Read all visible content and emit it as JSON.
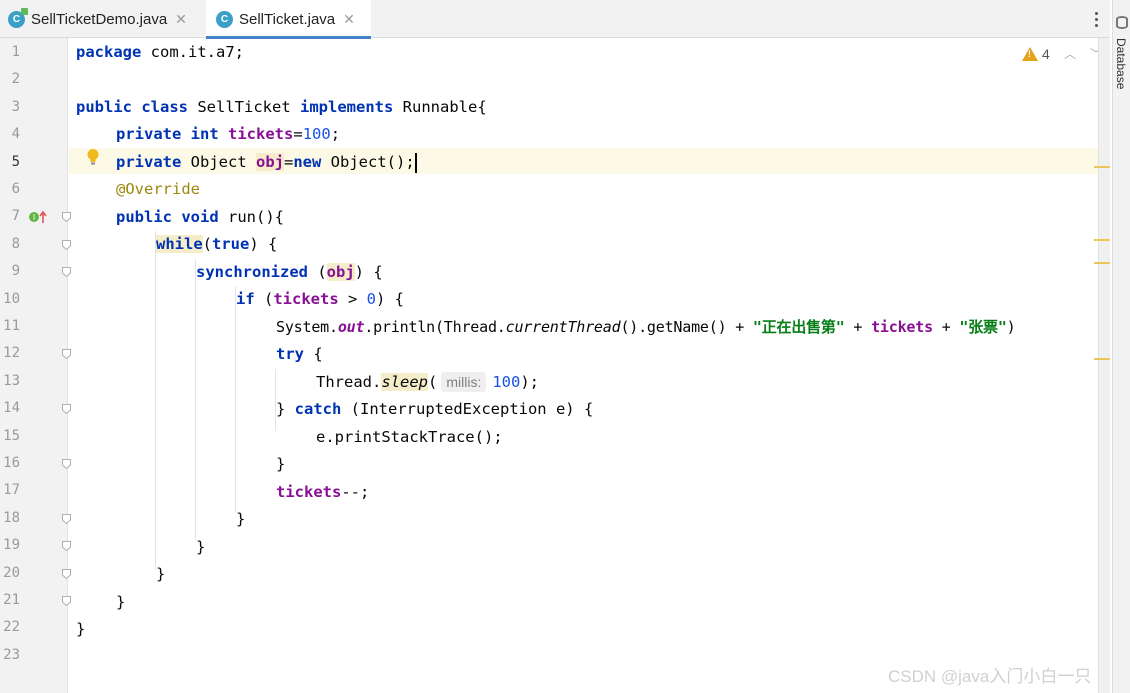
{
  "tabs": [
    {
      "name": "SellTicketDemo.java",
      "icon_letter": "C"
    },
    {
      "name": "SellTicket.java",
      "icon_letter": "C"
    }
  ],
  "toolstrip": {
    "database_label": "Database"
  },
  "inspection": {
    "warning_count": "4"
  },
  "hint": {
    "millis_label": "millis:"
  },
  "watermark": "CSDN @java入门小白一只",
  "line_numbers": [
    "1",
    "2",
    "3",
    "4",
    "5",
    "6",
    "7",
    "8",
    "9",
    "10",
    "11",
    "12",
    "13",
    "14",
    "15",
    "16",
    "17",
    "18",
    "19",
    "20",
    "21",
    "22",
    "23"
  ],
  "code": {
    "l1": {
      "kw": "package",
      "rest": " com.it.a7;"
    },
    "l3": {
      "kw1": "public",
      "kw2": "class",
      "cls": " SellTicket ",
      "kw3": "implements",
      "rest": " Runnable{"
    },
    "l4": {
      "kw1": "private",
      "kw2": "int",
      "field": "tickets",
      "eq": "=",
      "num": "100",
      "end": ";"
    },
    "l5": {
      "kw1": "private",
      "type": " Object ",
      "field": "obj",
      "eq": "=",
      "kw2": "new",
      "rest": " Object();"
    },
    "l6": {
      "ann": "@Override"
    },
    "l7": {
      "kw1": "public",
      "kw2": "void",
      "rest": " run(){"
    },
    "l8": {
      "kw1": "while",
      "p1": "(",
      "kw2": "true",
      "rest": ") {"
    },
    "l9": {
      "kw": "synchronized",
      "p1": " (",
      "field": "obj",
      "rest": ") {"
    },
    "l10": {
      "kw": "if",
      "p1": " (",
      "field": "tickets",
      "p2": " > ",
      "num": "0",
      "rest": ") {"
    },
    "l11": {
      "a": "System.",
      "out": "out",
      "b": ".println(Thread.",
      "ct": "currentThread",
      "c": "().getName() + ",
      "s1": "\"正在出售第\"",
      "d": " + ",
      "field": "tickets",
      "e": " + ",
      "s2": "\"张票\"",
      "f": ")"
    },
    "l12": {
      "kw": "try",
      "rest": " {"
    },
    "l13": {
      "a": "Thread.",
      "sleep": "sleep",
      "p": "(",
      "num": "100",
      "end": ");"
    },
    "l14": {
      "a": "} ",
      "kw": "catch",
      "rest": " (InterruptedException e) {"
    },
    "l15": {
      "text": "e.printStackTrace();"
    },
    "l16": {
      "text": "}"
    },
    "l17": {
      "field": "tickets",
      "rest": "--;"
    },
    "l18": {
      "text": "}"
    },
    "l19": {
      "text": "}"
    },
    "l20": {
      "text": "}"
    },
    "l21": {
      "text": "}"
    },
    "l22": {
      "text": "}"
    }
  }
}
